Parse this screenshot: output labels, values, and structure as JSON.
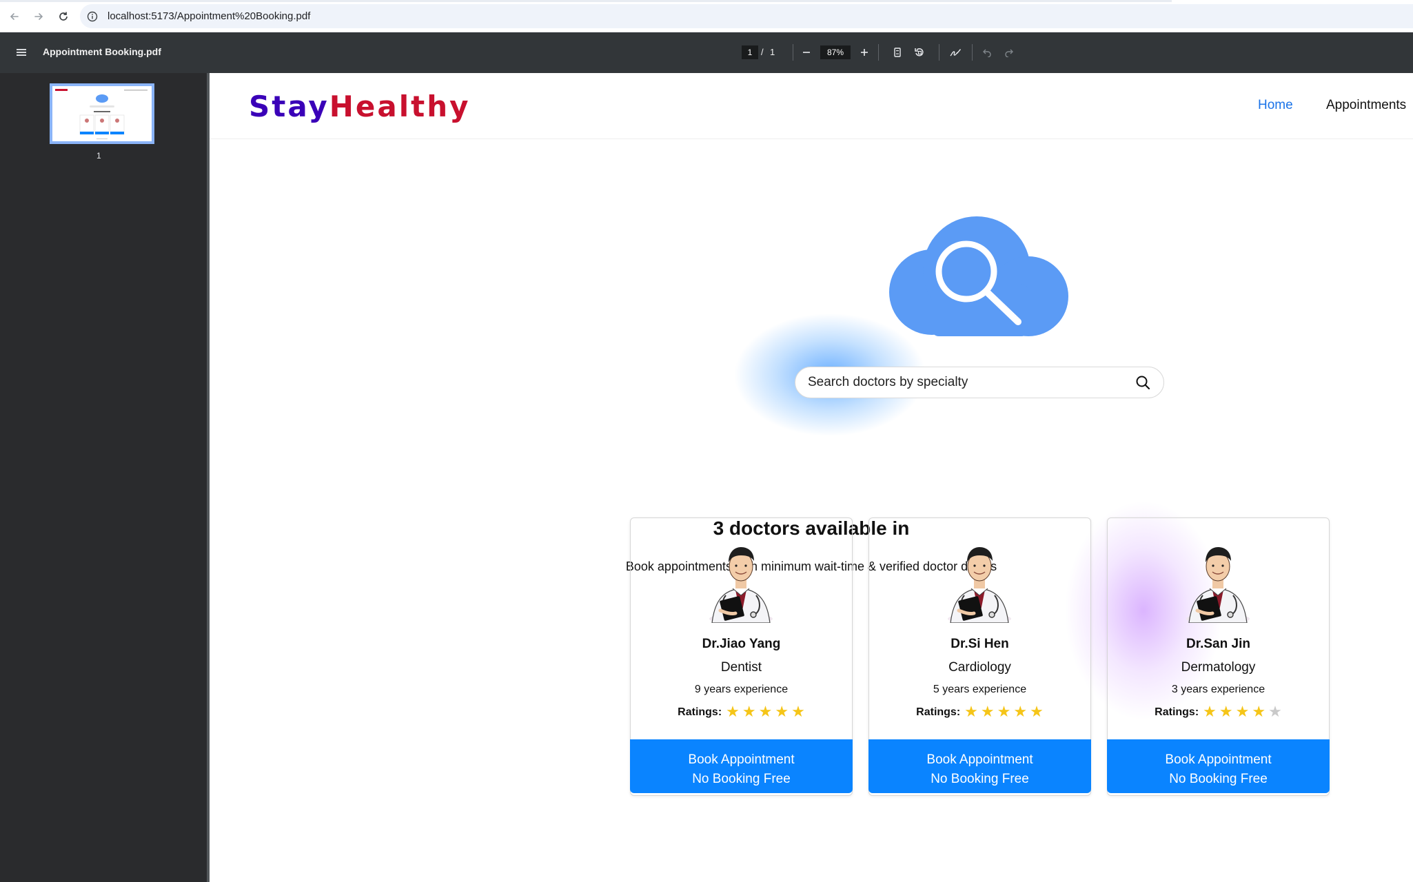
{
  "browser": {
    "url": "localhost:5173/Appointment%20Booking.pdf"
  },
  "pdf_toolbar": {
    "title": "Appointment Booking.pdf",
    "current_page": "1",
    "separator": "/",
    "total_pages": "1",
    "zoom": "87%"
  },
  "sidebar": {
    "thumbnail_label": "1"
  },
  "site": {
    "logo_part1": "Stay",
    "logo_part2": "Healthy",
    "nav": {
      "home": "Home",
      "appointments": "Appointments"
    }
  },
  "search": {
    "placeholder": "Search doctors by specialty"
  },
  "headline": "3 doctors available in",
  "subline": "Book appointments with minimum wait-time & verified doctor details",
  "ratings_label": "Ratings:",
  "book_line1": "Book Appointment",
  "book_line2": "No Booking Free",
  "doctors": [
    {
      "name": "Dr.Jiao Yang",
      "specialty": "Dentist",
      "experience": "9 years experience",
      "rating": 5
    },
    {
      "name": "Dr.Si Hen",
      "specialty": "Cardiology",
      "experience": "5 years experience",
      "rating": 5
    },
    {
      "name": "Dr.San Jin",
      "specialty": "Dermatology",
      "experience": "3 years experience",
      "rating": 4
    }
  ],
  "colors": {
    "accent_blue": "#0a84ff",
    "link_blue": "#1a73e8",
    "logo_purple": "#3a00b8",
    "logo_red": "#c8102e",
    "star_gold": "#f5c518",
    "cloud_blue": "#5b9bf5"
  }
}
